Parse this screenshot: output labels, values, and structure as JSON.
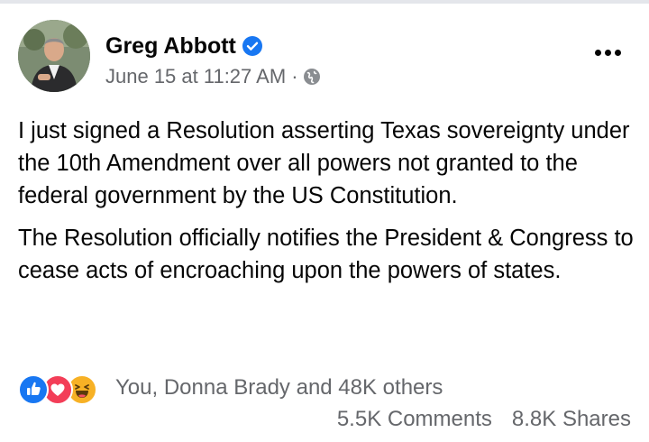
{
  "post": {
    "author": {
      "name": "Greg Abbott",
      "verified": true,
      "verified_color": "#1877f2"
    },
    "timestamp": "June 15 at 11:27 AM",
    "separator": "·",
    "audience_icon": "globe-icon",
    "body": {
      "paragraph_1": "I just signed a Resolution asserting Texas sovereignty under the 10th Amendment over all powers not granted to the federal government by the US Constitution.",
      "paragraph_2": "The Resolution officially notifies the President & Congress to cease acts of encroaching upon the powers of states."
    },
    "reactions": {
      "icons": [
        "like-icon",
        "love-icon",
        "haha-icon"
      ],
      "summary": "You, Donna Brady and 48K others"
    },
    "comments_count": "5.5K Comments",
    "shares_count": "8.8K Shares"
  },
  "colors": {
    "text_primary": "#050505",
    "text_secondary": "#65676b",
    "like_blue": "#1877f2",
    "love_red": "#f33e58",
    "haha_yellow": "#f7b125"
  }
}
